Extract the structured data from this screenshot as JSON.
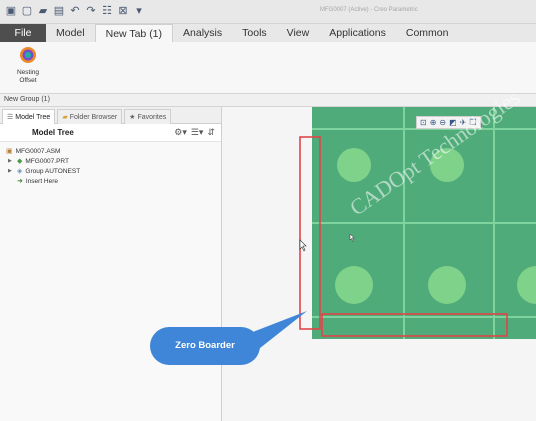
{
  "window": {
    "title": "MFG0007 (Active) - Creo Parametric"
  },
  "quick_access": {
    "icons": [
      "app-menu-icon",
      "new-file-icon",
      "open-folder-icon",
      "save-icon",
      "undo-icon",
      "redo-icon",
      "regenerate-icon",
      "close-window-icon",
      "customize-dropdown-icon"
    ]
  },
  "ribbon": {
    "tabs": [
      "File",
      "Model",
      "New Tab (1)",
      "Analysis",
      "Tools",
      "View",
      "Applications",
      "Common"
    ],
    "active_tab": "New Tab (1)",
    "nesting_button": {
      "label": "Nesting\nOffset"
    },
    "group_label": "New Group (1)"
  },
  "left_panel": {
    "tabs": [
      "Model Tree",
      "Folder Browser",
      "Favorites"
    ],
    "active_tab": "Model Tree",
    "tree_title": "Model Tree",
    "tree": [
      {
        "label": "MFG0007.ASM",
        "level": 0
      },
      {
        "label": "MFG0007.PRT",
        "level": 1
      },
      {
        "label": "Group AUTONEST",
        "level": 1
      },
      {
        "label": "Insert Here",
        "level": 1
      }
    ]
  },
  "graphics": {
    "callout": "Zero Boarder",
    "watermark": "CADOpt Technologies",
    "colors": {
      "stock": "#4fab79",
      "highlight": "#e0454a",
      "callout": "#3f86d8"
    }
  }
}
